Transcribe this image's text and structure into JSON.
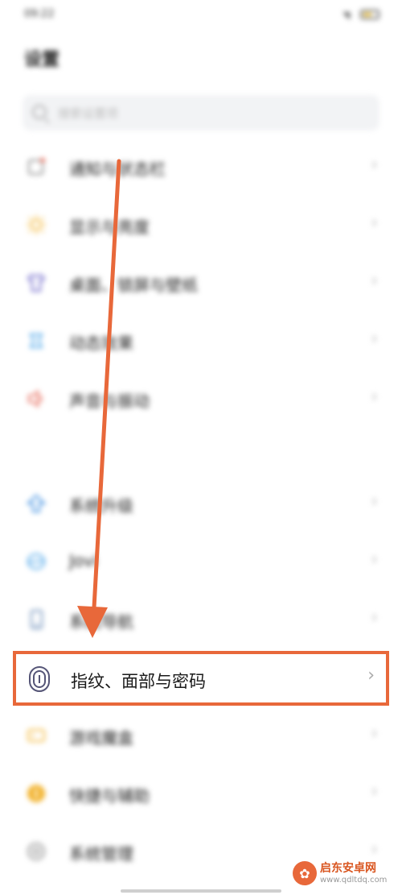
{
  "status": {
    "time": "09:22"
  },
  "header": {
    "title": "设置"
  },
  "search": {
    "placeholder": "搜索设置项"
  },
  "menu": [
    {
      "label": "通知与状态栏",
      "icon": "notification-icon",
      "color": "#e86c5a"
    },
    {
      "label": "显示与亮度",
      "icon": "brightness-icon",
      "color": "#f2b431"
    },
    {
      "label": "桌面、锁屏与壁纸",
      "icon": "theme-shirt-icon",
      "color": "#6a62c8"
    },
    {
      "label": "动态效果",
      "icon": "motion-effects-icon",
      "color": "#4aa4e8"
    },
    {
      "label": "声音与振动",
      "icon": "speaker-icon",
      "color": "#e66a5a"
    },
    {
      "label": "系统升级",
      "icon": "upgrade-arrow-icon",
      "color": "#3d8ee0"
    },
    {
      "label": "Jovi",
      "icon": "jovi-icon",
      "color": "#4aa4e8"
    },
    {
      "label": "系统导航",
      "icon": "phone-navigation-icon",
      "color": "#6b8cb8"
    },
    {
      "label": "指纹、面部与密码",
      "icon": "fingerprint-icon",
      "color": "#555577",
      "highlighted": true
    },
    {
      "label": "游戏魔盒",
      "icon": "game-box-icon",
      "color": "#f2b431"
    },
    {
      "label": "快捷与辅助",
      "icon": "shortcut-icon",
      "color": "#f2b431"
    },
    {
      "label": "系统管理",
      "icon": "system-gear-icon",
      "color": "#888888"
    }
  ],
  "accent": "#e8683a",
  "watermark": {
    "name": "启东安卓网",
    "url": "www.qdltdq.com"
  }
}
